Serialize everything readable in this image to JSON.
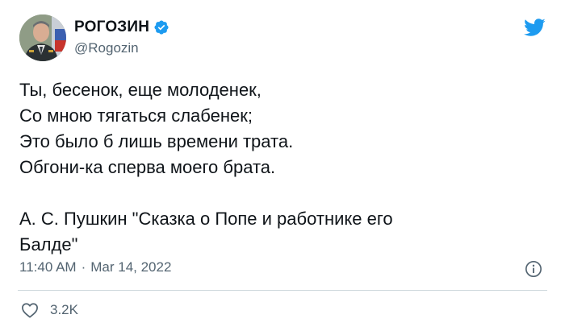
{
  "author": {
    "display_name": "РОГОЗИН",
    "handle": "@Rogozin",
    "verified": true
  },
  "tweet": {
    "lines": [
      "Ты, бесенок, еще молоденек,",
      "Со мною тягаться слабенек;",
      "Это было б лишь времени трата.",
      "Обгони-ка сперва моего брата.",
      "",
      "А. С. Пушкин \"Сказка о Попе и работнике его",
      "Балде\""
    ]
  },
  "meta": {
    "time": "11:40 AM",
    "separator": "·",
    "date": "Mar 14, 2022"
  },
  "actions": {
    "like_count": "3.2K"
  },
  "icons": {
    "brand": "twitter-bird-icon",
    "verified": "verified-badge-icon",
    "info": "info-icon",
    "like": "heart-icon"
  },
  "colors": {
    "brand": "#1d9bf0",
    "text": "#0f1419",
    "secondary": "#536471",
    "divider": "#cfd9de"
  }
}
